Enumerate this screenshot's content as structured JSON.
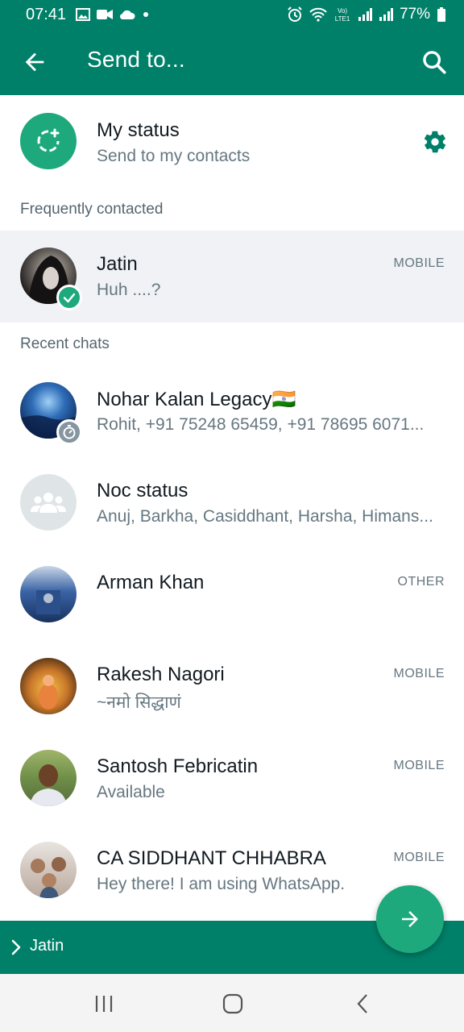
{
  "status_bar": {
    "time": "07:41",
    "battery": "77%"
  },
  "app_bar": {
    "title": "Send to..."
  },
  "my_status": {
    "name": "My status",
    "subtitle": "Send to my contacts"
  },
  "sections": {
    "frequent": "Frequently contacted",
    "recent": "Recent chats"
  },
  "frequent_contacts": [
    {
      "name": "Jatin",
      "subtitle": "Huh ....?",
      "tag": "MOBILE",
      "selected": true
    }
  ],
  "recent_chats": [
    {
      "name": "Nohar Kalan Legacy🇮🇳",
      "subtitle": "Rohit, +91 75248 65459, +91 78695 6071...",
      "tag": ""
    },
    {
      "name": "Noc status",
      "subtitle": "Anuj, Barkha, Casiddhant, Harsha, Himans...",
      "tag": ""
    },
    {
      "name": "Arman Khan",
      "subtitle": "",
      "tag": "OTHER"
    },
    {
      "name": "Rakesh Nagori",
      "subtitle": "~नमो सिद्धाणं",
      "tag": "MOBILE"
    },
    {
      "name": "Santosh Febricatin",
      "subtitle": "Available",
      "tag": "MOBILE"
    },
    {
      "name": "CA SIDDHANT CHHABRA",
      "subtitle": "Hey there! I am using WhatsApp.",
      "tag": "MOBILE"
    }
  ],
  "selection_bar": {
    "selected_name": "Jatin"
  },
  "colors": {
    "primary": "#008069",
    "accent": "#1da97c",
    "secondary_text": "#667781"
  }
}
